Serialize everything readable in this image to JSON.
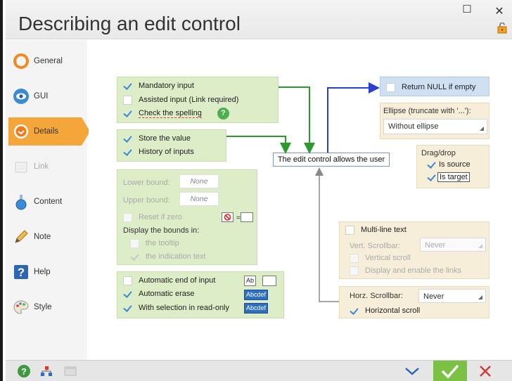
{
  "window": {
    "title": "Describing an edit control",
    "maximize_glyph": "☐",
    "close_glyph": "✕"
  },
  "sidebar": {
    "items": [
      {
        "label": "General",
        "icon": "general-icon"
      },
      {
        "label": "GUI",
        "icon": "gui-eye-icon"
      },
      {
        "label": "Details",
        "icon": "details-icon",
        "active": true
      },
      {
        "label": "Link",
        "icon": "link-icon",
        "disabled": true
      },
      {
        "label": "Content",
        "icon": "content-flask-icon"
      },
      {
        "label": "Note",
        "icon": "note-pencil-icon"
      },
      {
        "label": "Help",
        "icon": "help-icon"
      },
      {
        "label": "Style",
        "icon": "style-palette-icon"
      }
    ]
  },
  "group_input": {
    "mandatory": {
      "label": "Mandatory input",
      "checked": true
    },
    "assisted": {
      "label": "Assisted input (Link required)",
      "checked": false
    },
    "spelling": {
      "label": "Check the spelling",
      "checked": true
    }
  },
  "group_store": {
    "store": {
      "label": "Store the value",
      "checked": true
    },
    "history": {
      "label": "History of inputs",
      "checked": true
    }
  },
  "group_bounds": {
    "lower_label": "Lower bound:",
    "lower_value": "None",
    "upper_label": "Upper bound:",
    "upper_value": "None",
    "reset_label": "Reset if zero",
    "display_label": "Display the bounds in:",
    "tooltip_label": "the tooltip",
    "indication_label": "the indication text"
  },
  "group_erase": {
    "auto_end": {
      "label": "Automatic end of input",
      "checked": false,
      "sample": "Ab"
    },
    "auto_erase": {
      "label": "Automatic erase",
      "checked": true,
      "sample": "Abcdef"
    },
    "selection_ro": {
      "label": "With selection in read-only",
      "checked": true,
      "sample": "Abcdef"
    }
  },
  "center_label": "The edit control allows the user",
  "return_null": {
    "label": "Return NULL if empty",
    "checked": false
  },
  "ellipse": {
    "label": "Ellipse (truncate with '...'):",
    "value": "Without ellipse"
  },
  "dragdrop": {
    "title": "Drag/drop",
    "is_source": {
      "label": "Is source",
      "checked": true
    },
    "is_target": {
      "label": "Is target",
      "checked": true
    }
  },
  "multiline": {
    "label": "Multi-line text",
    "checked": false,
    "vscroll_label": "Vert. Scrollbar:",
    "vscroll_value": "Never",
    "vertical_scroll": "Vertical scroll",
    "display_links": "Display and enable the links"
  },
  "hscroll": {
    "label": "Horz. Scrollbar:",
    "value": "Never",
    "horizontal_scroll": {
      "label": "Horizontal scroll",
      "checked": true
    }
  },
  "colors": {
    "accent": "#f4a63a",
    "green_panel": "#dcedc8",
    "beige_panel": "#f6eed9",
    "blue_panel": "#cfe0f2",
    "arrow_green": "#2a9a2a",
    "arrow_blue": "#2a3fd6",
    "ok_button": "#7bc144"
  }
}
